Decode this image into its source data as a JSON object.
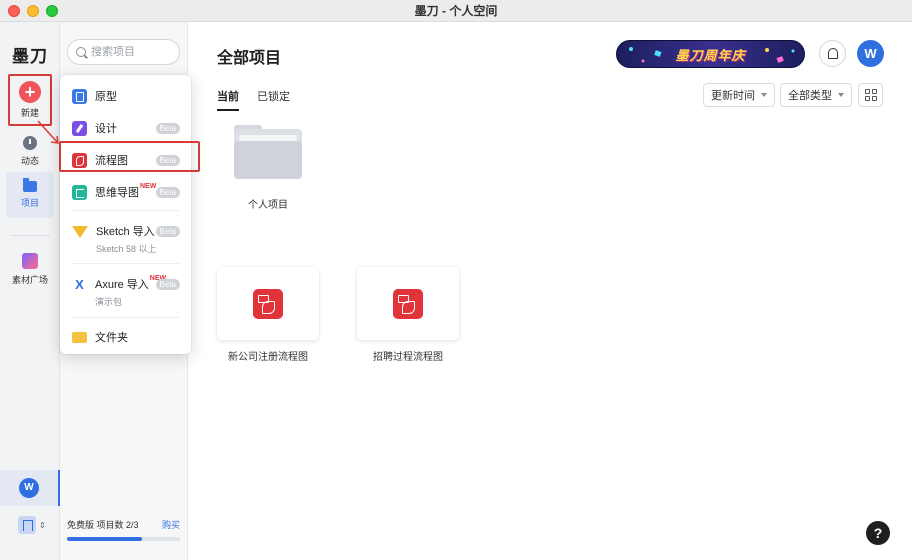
{
  "window": {
    "title": "墨刀 - 个人空间"
  },
  "rail": {
    "logo": "墨刀",
    "new_label": "新建",
    "items": [
      {
        "label": "动态",
        "icon": "clock-icon"
      },
      {
        "label": "项目",
        "icon": "folder-icon",
        "active": true
      },
      {
        "label": "素材广场",
        "icon": "assets-icon"
      }
    ],
    "user_initial": "W",
    "team_icon": "building-icon"
  },
  "sidebar": {
    "search_placeholder": "搜索项目",
    "plan": {
      "label": "免费版 项目数 2/3",
      "buy": "购买",
      "usage_used": 2,
      "usage_total": 3
    }
  },
  "menu": {
    "items": [
      {
        "label": "原型",
        "icon": "prototype-icon"
      },
      {
        "label": "设计",
        "badge": "Beta",
        "icon": "design-icon"
      },
      {
        "label": "流程图",
        "badge": "Beta",
        "icon": "flowchart-icon",
        "highlighted": true
      },
      {
        "label": "思维导图",
        "tag": "NEW",
        "badge": "Beta",
        "icon": "mindmap-icon"
      },
      {
        "label": "Sketch 导入",
        "sub": "Sketch 58 以上",
        "badge": "Beta",
        "icon": "sketch-icon"
      },
      {
        "label": "Axure 导入",
        "tag": "NEW",
        "sub": "演示包",
        "badge": "Beta",
        "icon": "axure-icon"
      },
      {
        "label": "文件夹",
        "icon": "folder-icon"
      }
    ]
  },
  "main": {
    "title": "全部项目",
    "banner_text": "墨刀周年庆",
    "user_initial": "W",
    "tabs": [
      {
        "label": "当前",
        "active": true
      },
      {
        "label": "已锁定"
      }
    ],
    "sort": {
      "label": "更新时间"
    },
    "type_filter": {
      "label": "全部类型"
    },
    "items": [
      {
        "label": "个人项目",
        "kind": "folder"
      },
      {
        "label": "新公司注册流程图",
        "kind": "flowchart"
      },
      {
        "label": "招聘过程流程图",
        "kind": "flowchart"
      }
    ],
    "help_label": "?"
  },
  "colors": {
    "accent": "#2f6fe0",
    "highlight_box": "#d83a3a",
    "flowchart": "#e0333a"
  }
}
